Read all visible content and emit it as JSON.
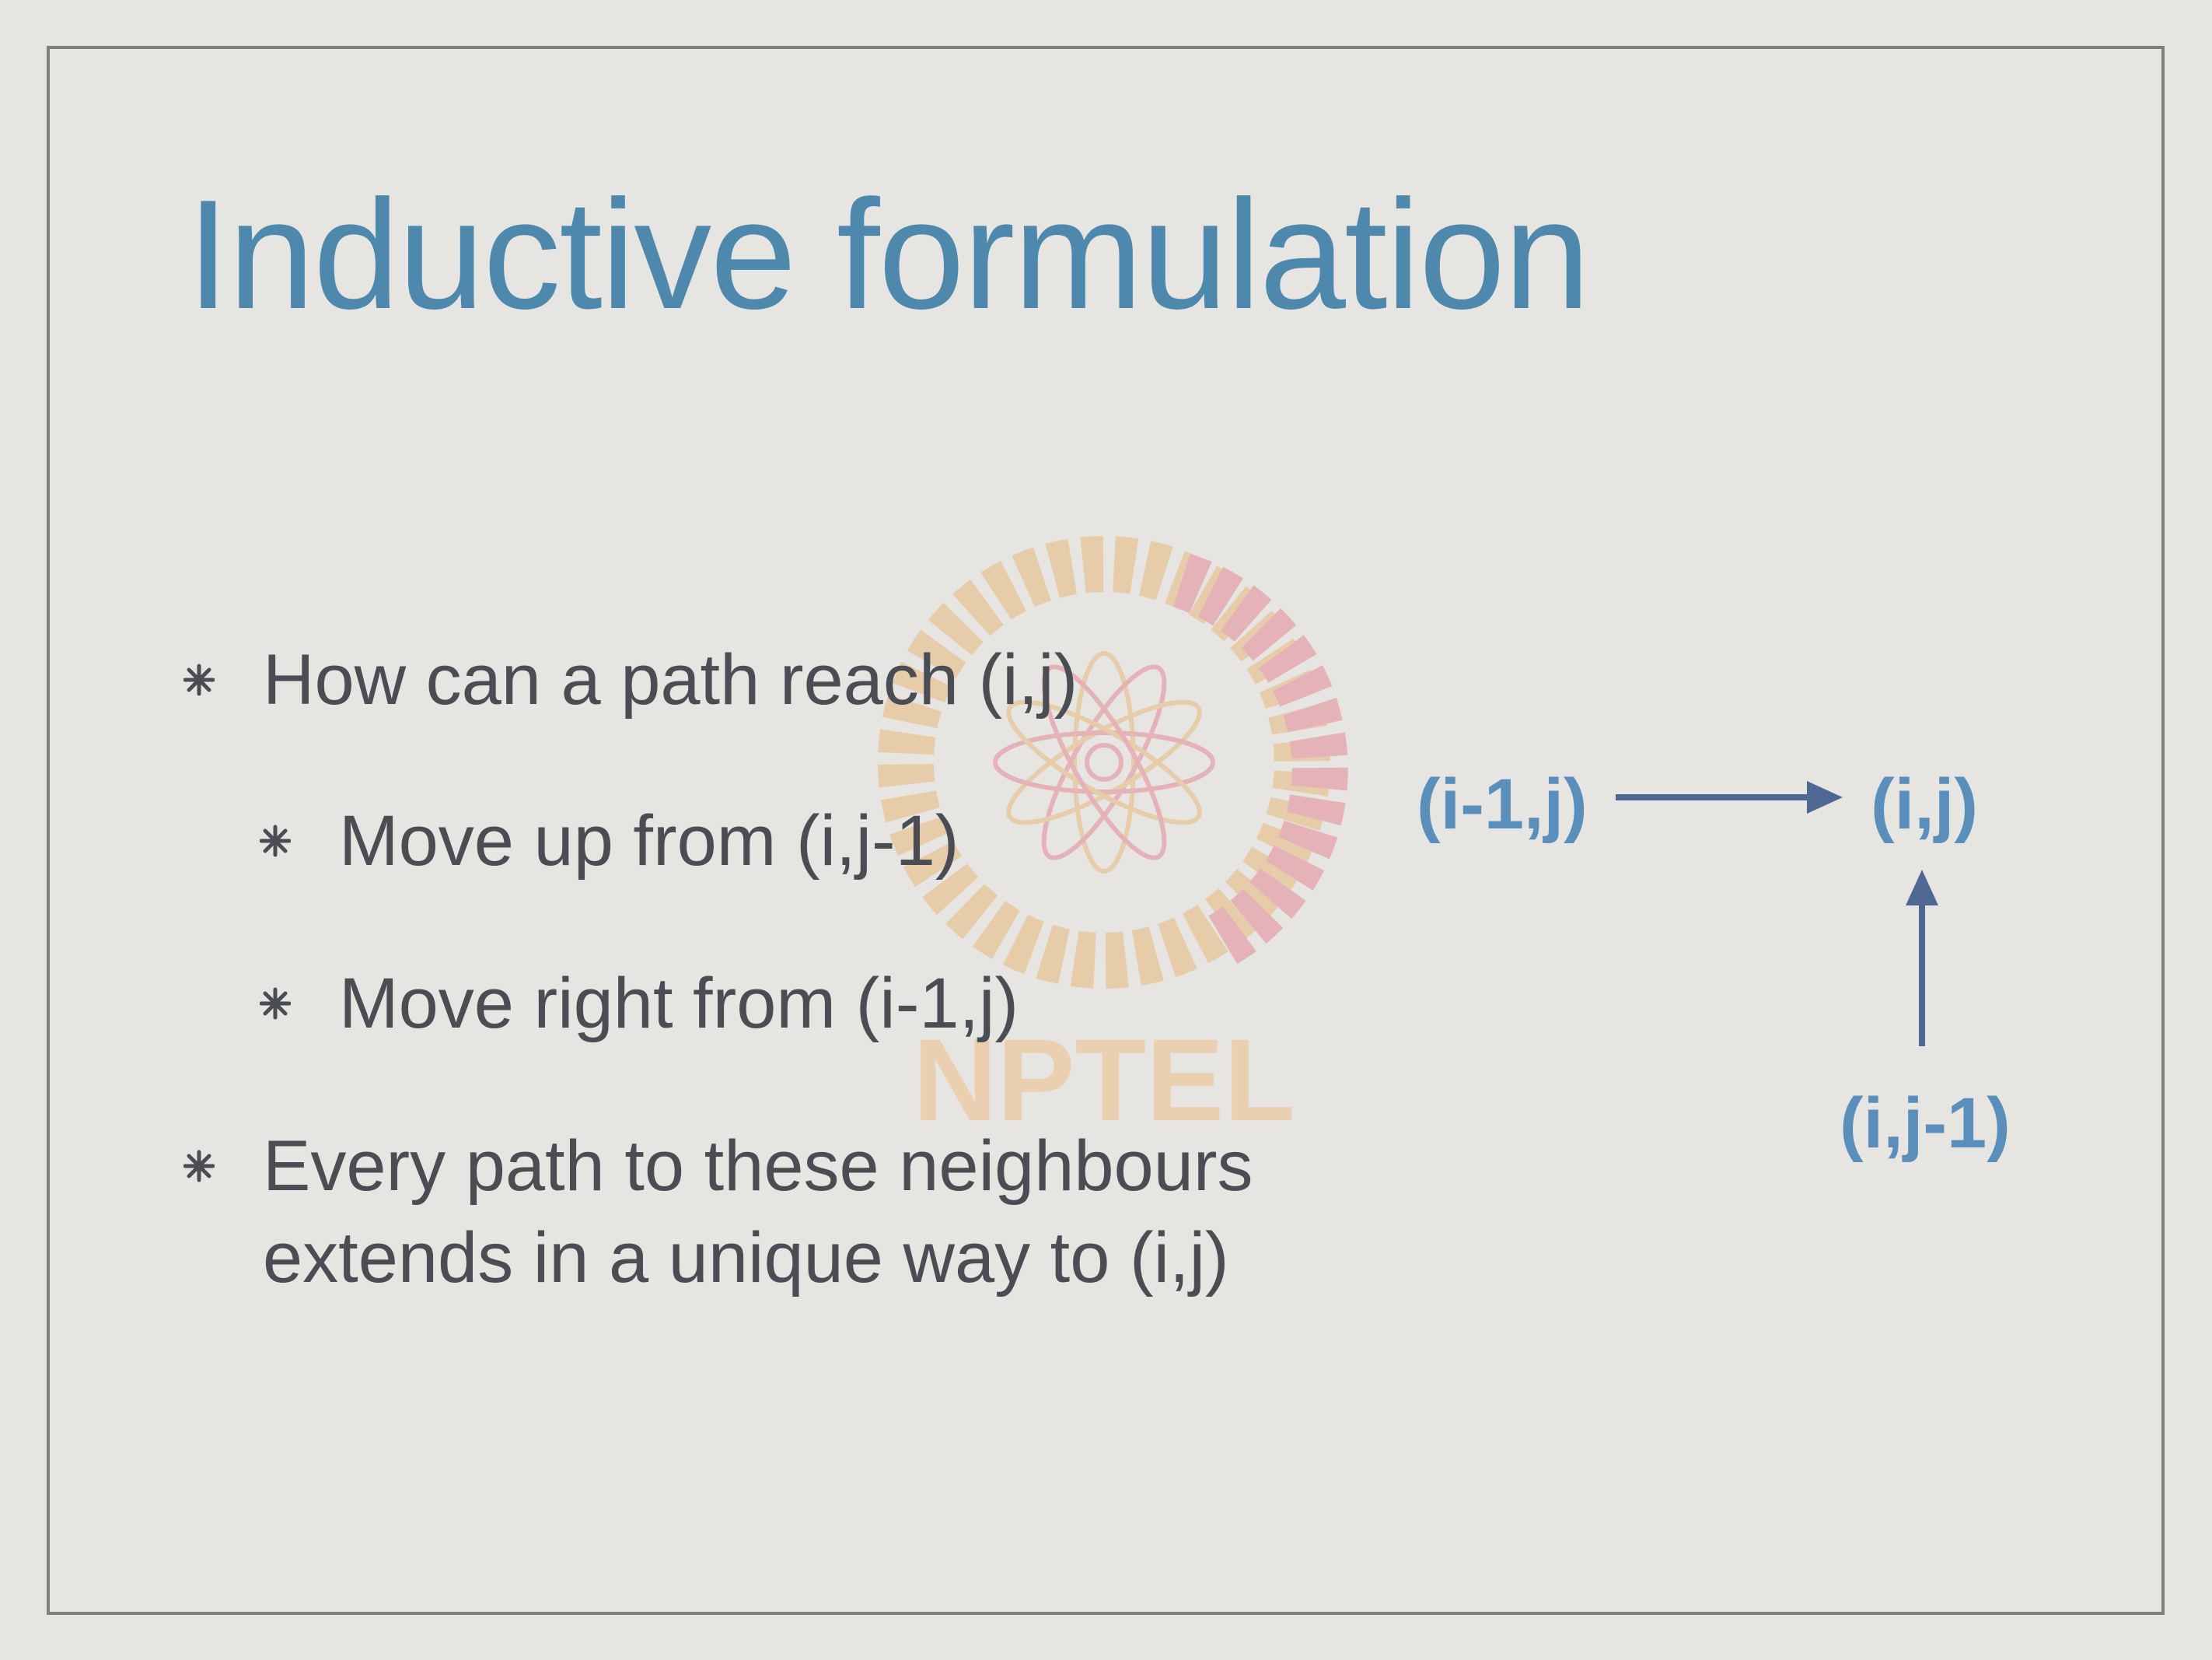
{
  "slide": {
    "title": "Inductive formulation",
    "bullets": [
      {
        "text": "How can a path reach (i,j)"
      },
      {
        "text": "Move up from (i,j-1)"
      },
      {
        "text": "Move right from (i-1,j)"
      },
      {
        "text_line1": "Every path to these neighbours",
        "text_line2": "extends in a unique way to (i,j)"
      }
    ],
    "diagram": {
      "left_node": "(i-1,j)",
      "target_node": "(i,j)",
      "below_node": "(i,j-1)"
    },
    "watermark": {
      "text": "NPTEL"
    },
    "colors": {
      "title": "#4e88ac",
      "body_text": "#4b4d54",
      "diagram_label": "#5b8fbb",
      "arrow": "#4e6793",
      "frame": "#807f7c",
      "background": "#e6e5e1"
    },
    "icons": {
      "bullet": "asterisk-bullet-icon",
      "watermark_logo": "nptel-logo-icon"
    }
  }
}
